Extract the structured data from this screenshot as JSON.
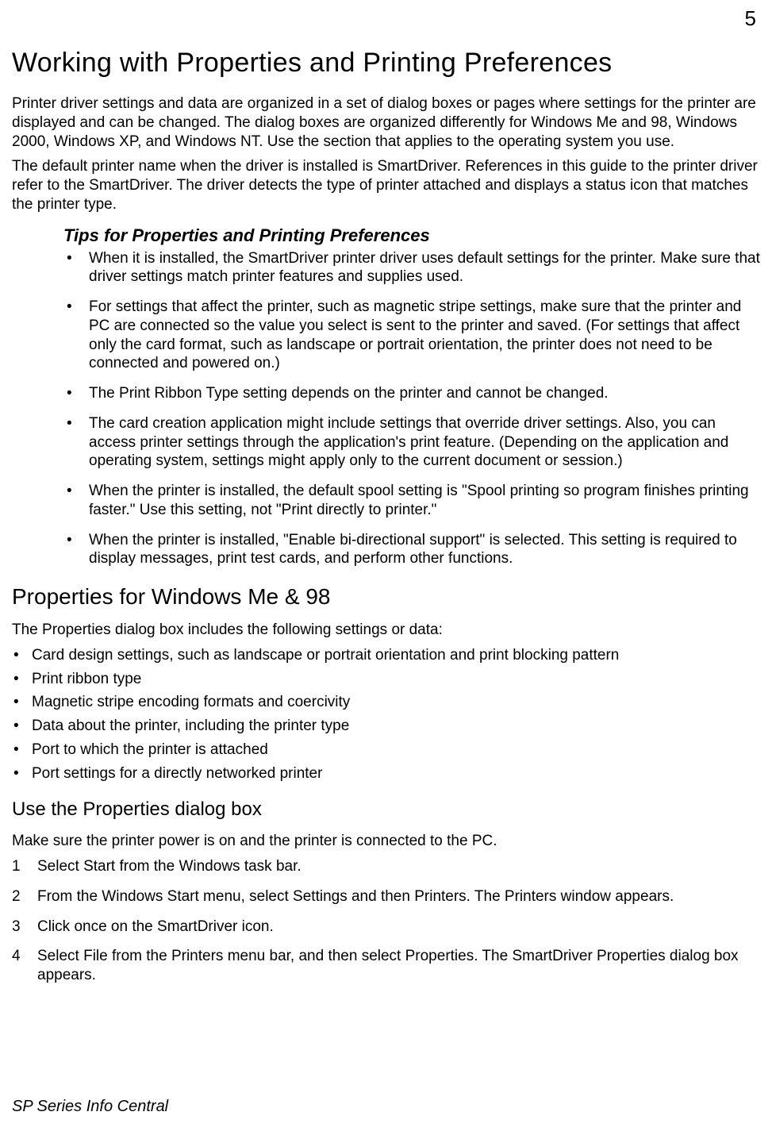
{
  "page_number": "5",
  "heading1": "Working with Properties and Printing Preferences",
  "intro_p1": "Printer driver settings and data are organized in a set of dialog boxes or pages where settings for the printer are displayed and can be changed. The dialog boxes are organized differently for Windows Me and 98, Windows 2000, Windows XP, and Windows NT. Use the section that applies to the operating system you use.",
  "intro_p2": "The default printer name when the driver is installed is SmartDriver. References in this guide to the printer driver refer to the SmartDriver. The driver detects the type of printer attached and displays a status icon that matches the printer type.",
  "tips_heading": "Tips for Properties and Printing Preferences",
  "tips": [
    "When it is installed, the SmartDriver printer driver uses default settings for the printer. Make sure that driver settings match printer features and supplies used.",
    "For settings that affect the printer, such as magnetic stripe settings, make sure that the printer and PC are connected so the value you select is sent to the printer and saved. (For settings that affect only the card format, such as landscape or portrait orientation, the printer does not need to be connected and powered on.)",
    "The Print Ribbon Type setting depends on the printer and cannot be changed.",
    "The card creation application might include settings that override driver settings. Also, you can access printer settings through the application's print feature. (Depending on the application and operating system, settings might apply only to the current document or session.)",
    "When the printer is installed, the default spool setting is \"Spool printing so program finishes printing faster.\" Use this setting, not \"Print directly to printer.\"",
    "When the printer is installed, \"Enable bi-directional support\" is selected. This setting is required to display messages, print test cards, and perform other functions."
  ],
  "heading2": "Properties for Windows Me & 98",
  "props_intro": "The Properties dialog box includes the following settings or data:",
  "props": [
    "Card design settings, such as landscape or portrait orientation and print blocking pattern",
    "Print ribbon type",
    "Magnetic stripe encoding formats and coercivity",
    "Data about the printer, including the printer type",
    "Port to which the printer is attached",
    "Port settings for a directly networked printer"
  ],
  "heading3": "Use the Properties dialog box",
  "steps_intro": "Make sure the printer power is on and the printer is connected to the PC.",
  "steps": [
    "Select Start from the Windows task bar.",
    "From the Windows Start menu, select Settings and then Printers. The Printers window appears.",
    "Click once on the SmartDriver icon.",
    "Select File from the Printers menu bar, and then select Properties. The SmartDriver Properties dialog box appears."
  ],
  "footer": "SP Series Info Central"
}
